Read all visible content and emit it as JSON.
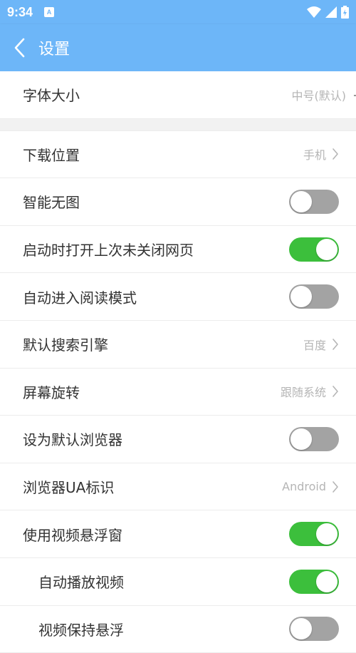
{
  "status_bar": {
    "time": "9:34",
    "notif_icon_letter": "A"
  },
  "header": {
    "title": "设置"
  },
  "colors": {
    "primary": "#6db6f8",
    "toggle_on": "#3cbf3c",
    "toggle_off": "#a3a3a3"
  },
  "font_size": {
    "label": "字体大小",
    "value": "中号(默认)"
  },
  "items": [
    {
      "label": "下载位置",
      "value": "手机",
      "type": "nav"
    },
    {
      "label": "智能无图",
      "type": "toggle",
      "on": false
    },
    {
      "label": "启动时打开上次未关闭网页",
      "type": "toggle",
      "on": true
    },
    {
      "label": "自动进入阅读模式",
      "type": "toggle",
      "on": false
    },
    {
      "label": "默认搜索引擎",
      "value": "百度",
      "type": "nav"
    },
    {
      "label": "屏幕旋转",
      "value": "跟随系统",
      "type": "nav"
    },
    {
      "label": "设为默认浏览器",
      "type": "toggle",
      "on": false
    },
    {
      "label": "浏览器UA标识",
      "value": "Android",
      "type": "nav"
    },
    {
      "label": "使用视频悬浮窗",
      "type": "toggle",
      "on": true
    },
    {
      "label": "自动播放视频",
      "type": "toggle",
      "on": true,
      "indent": true
    },
    {
      "label": "视频保持悬浮",
      "type": "toggle",
      "on": false,
      "indent": true
    }
  ]
}
